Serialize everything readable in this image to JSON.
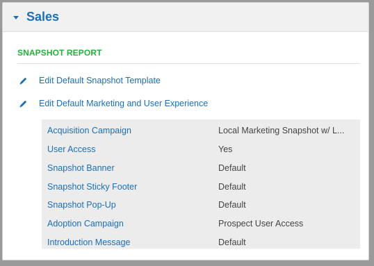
{
  "panel": {
    "title": "Sales",
    "section_label": "SNAPSHOT REPORT"
  },
  "actions": [
    {
      "label": "Edit Default Snapshot Template",
      "icon": "pencil-icon"
    },
    {
      "label": "Edit Default Marketing and User Experience",
      "icon": "pencil-icon"
    }
  ],
  "properties": [
    {
      "key": "Acquisition Campaign",
      "value": "Local Marketing Snapshot w/ L..."
    },
    {
      "key": "User Access",
      "value": "Yes"
    },
    {
      "key": "Snapshot Banner",
      "value": "Default"
    },
    {
      "key": "Snapshot Sticky Footer",
      "value": "Default"
    },
    {
      "key": "Snapshot Pop-Up",
      "value": "Default"
    },
    {
      "key": "Adoption Campaign",
      "value": "Prospect User Access"
    },
    {
      "key": "Introduction Message",
      "value": "Default"
    }
  ],
  "colors": {
    "link": "#1a6fb8",
    "section_label": "#22b33a",
    "header_bg": "#f1f1f1",
    "table_bg": "#ececec"
  }
}
